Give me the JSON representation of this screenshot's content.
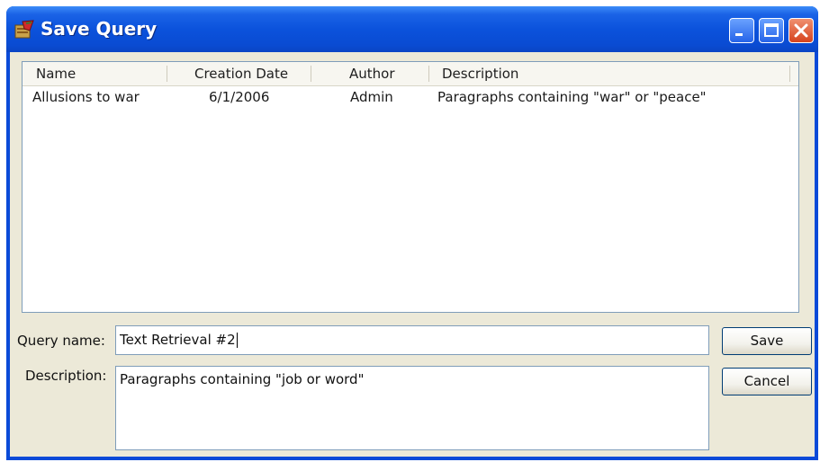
{
  "window": {
    "title": "Save Query",
    "icon": "app-icon",
    "controls": {
      "minimize": "minimize-icon",
      "maximize": "maximize-icon",
      "close": "close-icon"
    }
  },
  "table": {
    "headers": [
      "Name",
      "Creation Date",
      "Author",
      "Description"
    ],
    "rows": [
      {
        "name": "Allusions to war",
        "creation_date": "6/1/2006",
        "author": "Admin",
        "description": "Paragraphs containing \"war\" or \"peace\""
      }
    ]
  },
  "form": {
    "query_name_label": "Query name:",
    "query_name_value": "Text Retrieval #2",
    "description_label": "Description:",
    "description_value": "Paragraphs containing \"job or word\""
  },
  "buttons": {
    "save": "Save",
    "cancel": "Cancel"
  },
  "colors": {
    "titlebar": "#0b52dc",
    "close_button": "#d6431e",
    "dialog_bg": "#ece9d8"
  }
}
